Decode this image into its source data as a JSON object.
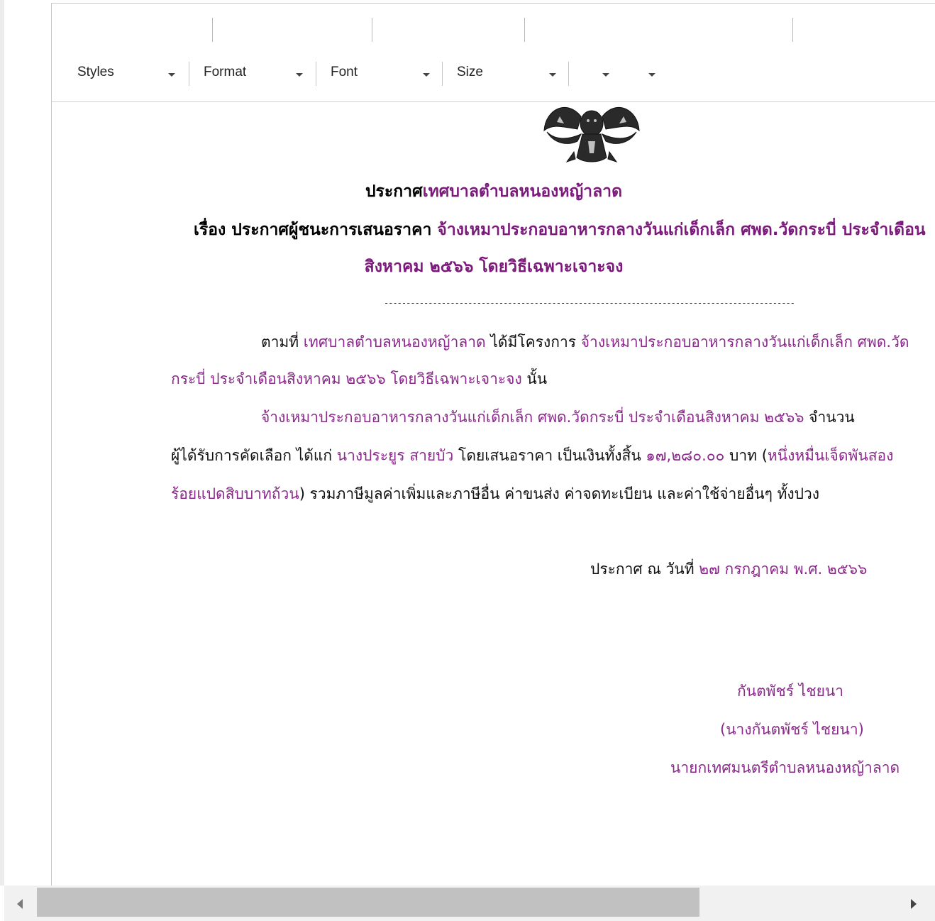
{
  "toolbar": {
    "styles_label": "Styles",
    "format_label": "Format",
    "font_label": "Font",
    "size_label": "Size",
    "text_color_label": "",
    "bg_color_label": ""
  },
  "doc": {
    "seal": "ตราครุฑ",
    "title_prefix": "ประกาศ",
    "title_org": "เทศบาลตำบลหนองหญ้าลาด",
    "subject_prefix": "เรื่อง ประกาศผู้ชนะการเสนอราคา ",
    "subject_project_line1": "จ้างเหมาประกอบอาหารกลางวันแก่เด็กเล็ก ศพด.วัดกระบี่ ประจำเดือน",
    "subject_line2": "สิงหาคม ๒๕๖๖ โดยวิธีเฉพาะเจาะจง",
    "divider": "------------------------------------------------------------------------------------------------------",
    "p1_prefix": "ตามที่ ",
    "p1_org": "เทศบาลตำบลหนองหญ้าลาด",
    "p1_mid": " ได้มีโครงการ ",
    "p1_project": "จ้างเหมาประกอบอาหารกลางวันแก่เด็กเล็ก ศพด.วัด",
    "p1_line2_project": "กระบี่ ประจำเดือนสิงหาคม ๒๕๖๖ โดยวิธีเฉพาะเจาะจง",
    "p1_line2_suffix": "  นั้น",
    "p2_project": "จ้างเหมาประกอบอาหารกลางวันแก่เด็กเล็ก ศพด.วัดกระบี่ ประจำเดือนสิงหาคม ๒๕๖๖",
    "p2_suffix": " จำนวน",
    "p3_prefix": "ผู้ได้รับการคัดเลือก ได้แก่ ",
    "p3_winner": "นางประยูร สายบัว",
    "p3_mid": " โดยเสนอราคา เป็นเงินทั้งสิ้น ",
    "p3_amount": "๑๗,๒๘๐.๐๐",
    "p3_unit": " บาท (",
    "p3_amount_words": "หนึ่งหมื่นเจ็ดพันสอง",
    "p4_amount_words": "ร้อยแปดสิบบาทถ้วน",
    "p4_suffix": ") รวมภาษีมูลค่าเพิ่มและภาษีอื่น ค่าขนส่ง ค่าจดทะเบียน และค่าใช้จ่ายอื่นๆ ทั้งปวง",
    "date_prefix": "ประกาศ ณ วันที่  ",
    "date_value": "๒๗ กรกฎาคม พ.ศ. ๒๕๖๖",
    "signer_name": "กันตพัชร์ ไชยนา",
    "signer_fullname": "(นางกันตพัชร์ ไชยนา)",
    "signer_position": "นายกเทศมนตรีตำบลหนองหญ้าลาด"
  },
  "colors": {
    "accent_purple": "#7b1a7b",
    "toolbar_text": "#222222",
    "scroll_thumb": "#c1c1c1"
  }
}
